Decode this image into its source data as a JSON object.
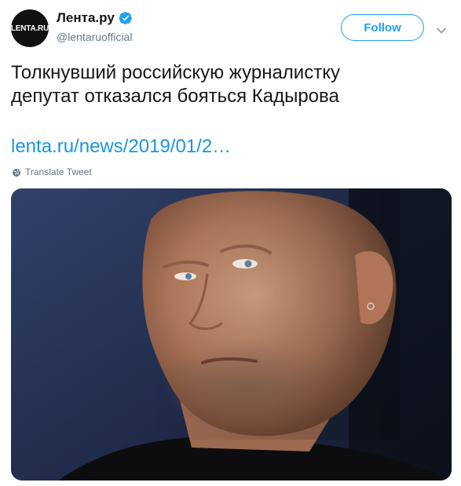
{
  "account": {
    "avatar_text": "LENTA.RU",
    "display_name": "Лента.ру",
    "handle": "@lentaruofficial",
    "verified_icon": "verified-badge-icon"
  },
  "actions": {
    "follow_label": "Follow",
    "more_icon": "chevron-down-icon"
  },
  "tweet": {
    "text_lines": [
      "Толкнувший российскую журналистку",
      "депутат отказался бояться Кадырова"
    ],
    "link_text": "lenta.ru/news/2019/01/2…",
    "translate_label": "Translate Tweet"
  },
  "media": {
    "type": "photo"
  },
  "colors": {
    "accent": "#1da1f2",
    "link": "#1b95e0",
    "secondary_text": "#657786",
    "primary_text": "#14171a"
  }
}
